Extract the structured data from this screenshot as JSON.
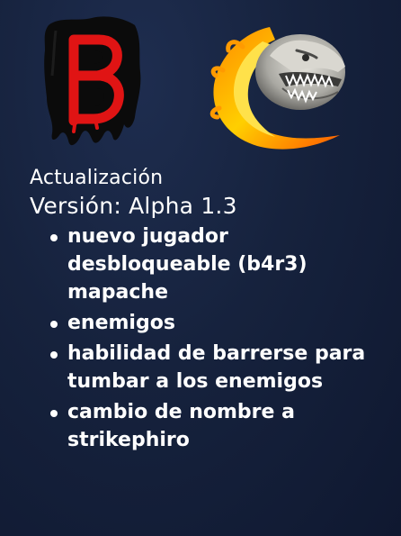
{
  "logos": [
    {
      "name": "b-logo",
      "icon": "black-splatter-red-b-logo",
      "lettering": "B",
      "color_bg": "#0a0a0a",
      "color_letter": "#e01212"
    },
    {
      "name": "phiro-logo",
      "icon": "flaming-beast-head-logo",
      "color_flame": "#f5a800",
      "color_head": "#cfcfc8"
    }
  ],
  "header": {
    "title": "Actualización",
    "version": "Versión: Alpha 1.3"
  },
  "changes": [
    "nuevo jugador desbloqueable (b4r3) mapache",
    "enemigos",
    "habilidad de barrerse para tumbar a los enemigos",
    "cambio de nombre a strikephiro"
  ]
}
